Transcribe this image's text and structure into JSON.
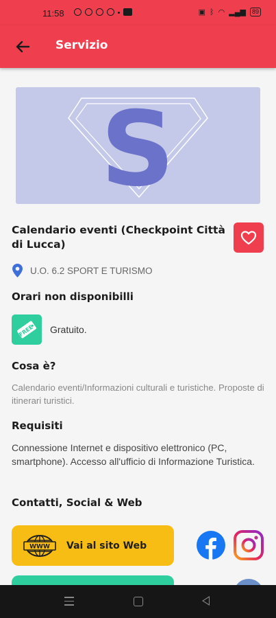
{
  "status_bar": {
    "time": "11:58",
    "battery": "89"
  },
  "app_bar": {
    "title": "Servizio"
  },
  "service": {
    "title": "Calendario eventi (Checkpoint Città di Lucca)",
    "location": "U.O. 6.2 SPORT E TURISMO",
    "hours_heading": "Orari non disponibilli",
    "price_label": "Gratuito.",
    "what_heading": "Cosa è?",
    "what_text": "Calendario eventi/Informazioni culturali e turistiche. Proposte di itinerari turistici.",
    "requirements_heading": "Requisiti",
    "requirements_text": "Connessione Internet e dispositivo elettronico (PC, smartphone). Accesso all'ufficio di Informazione Turistica.",
    "contacts_heading": "Contatti, Social & Web",
    "web_button": "Vai al sito Web",
    "www_icon_text": "WWW",
    "free_icon_text": "FREE"
  },
  "colors": {
    "brand": "#ef3f4f",
    "web_button": "#f8bd14",
    "accent_green": "#2fce9e",
    "banner_bg": "#c5c9e9"
  },
  "icons": [
    "back-arrow-icon",
    "heart-icon",
    "location-pin-icon",
    "free-tag-icon",
    "www-globe-icon",
    "facebook-icon",
    "instagram-icon"
  ]
}
